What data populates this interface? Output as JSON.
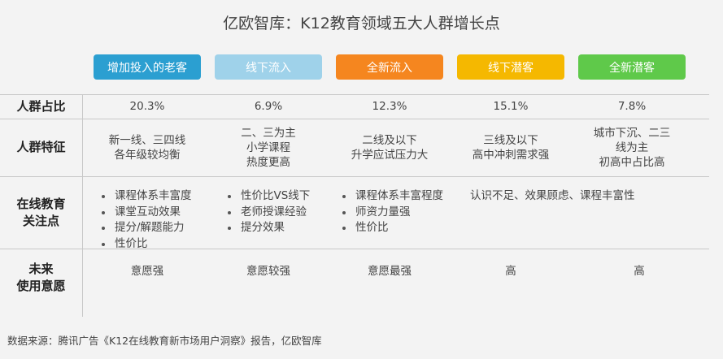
{
  "title": "亿欧智库：K12教育领域五大人群增长点",
  "segments": [
    {
      "label": "增加投入的老客",
      "color": "#2b9fd1"
    },
    {
      "label": "线下流入",
      "color": "#9fd2ea"
    },
    {
      "label": "全新流入",
      "color": "#f5861f"
    },
    {
      "label": "线下潜客",
      "color": "#f5b800"
    },
    {
      "label": "全新潜客",
      "color": "#5fc94a"
    }
  ],
  "row_labels": {
    "share": "人群占比",
    "traits": "人群特征",
    "focus_line1": "在线教育",
    "focus_line2": "关注点",
    "intent_line1": "未来",
    "intent_line2": "使用意愿"
  },
  "share": [
    "20.3%",
    "6.9%",
    "12.3%",
    "15.1%",
    "7.8%"
  ],
  "traits": [
    [
      "新一线、三四线",
      "各年级较均衡"
    ],
    [
      "二、三为主",
      "小学课程",
      "热度更高"
    ],
    [
      "二线及以下",
      "升学应试压力大"
    ],
    [
      "三线及以下",
      "高中冲刺需求强"
    ],
    [
      "城市下沉、二三",
      "线为主",
      "初高中占比高"
    ]
  ],
  "focus": {
    "col0": [
      "课程体系丰富度",
      "课堂互动效果",
      "提分/解题能力",
      "性价比"
    ],
    "col1": [
      "性价比VS线下",
      "老师授课经验",
      "提分效果"
    ],
    "col2": [
      "课程体系丰富程度",
      "师资力量强",
      "性价比"
    ],
    "col34": "认识不足、效果顾虑、课程丰富性"
  },
  "intent": [
    "意愿强",
    "意愿较强",
    "意愿最强",
    "高",
    "高"
  ],
  "source": "数据来源：腾讯广告《K12在线教育新市场用户洞察》报告，亿欧智库"
}
